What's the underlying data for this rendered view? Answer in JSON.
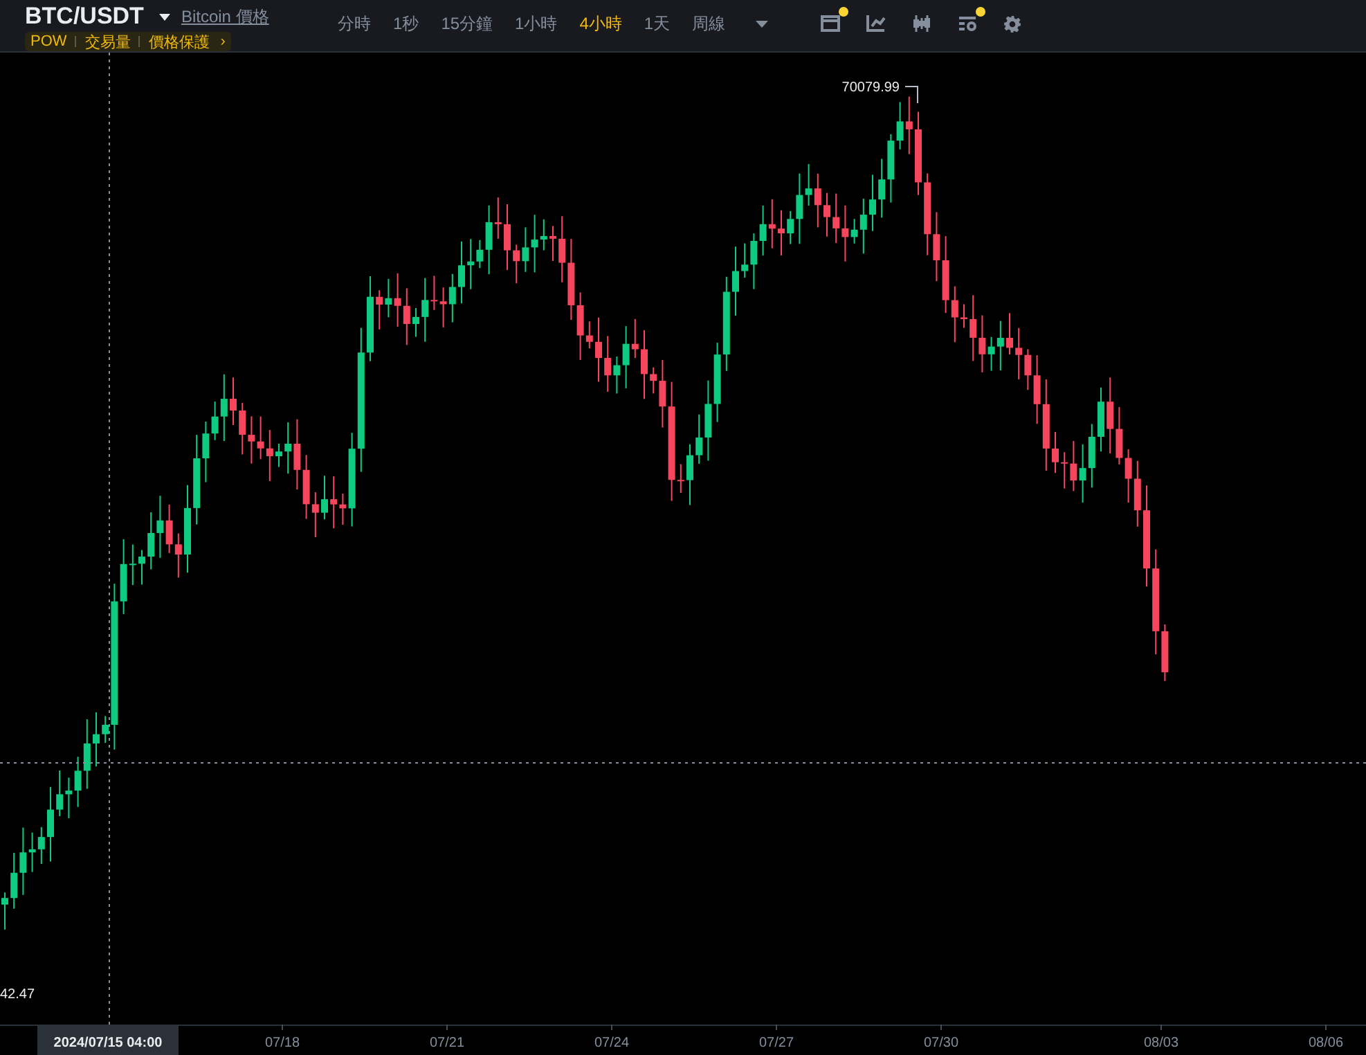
{
  "header": {
    "pair": "BTC/USDT",
    "price_link": "Bitcoin 價格",
    "tags": [
      "POW",
      "交易量",
      "價格保護"
    ],
    "tags_more": "›",
    "intervals": [
      {
        "label": "分時",
        "selected": false
      },
      {
        "label": "1秒",
        "selected": false
      },
      {
        "label": "15分鐘",
        "selected": false
      },
      {
        "label": "1小時",
        "selected": false
      },
      {
        "label": "4小時",
        "selected": true
      },
      {
        "label": "1天",
        "selected": false
      },
      {
        "label": "周線",
        "selected": false
      }
    ],
    "tools": [
      {
        "kind": "calendar",
        "badge": true
      },
      {
        "kind": "indicator",
        "badge": false
      },
      {
        "kind": "candles",
        "badge": false
      },
      {
        "kind": "filter",
        "badge": true
      },
      {
        "kind": "settings",
        "badge": false
      }
    ]
  },
  "chart": {
    "high_label": "70079.99",
    "crosshair_price": "42.47",
    "crosshair_time": "2024/07/15 04:00",
    "x_axis_labels": [
      "07/18",
      "07/21",
      "07/24",
      "07/27",
      "07/30",
      "08/03",
      "08/06"
    ]
  }
}
